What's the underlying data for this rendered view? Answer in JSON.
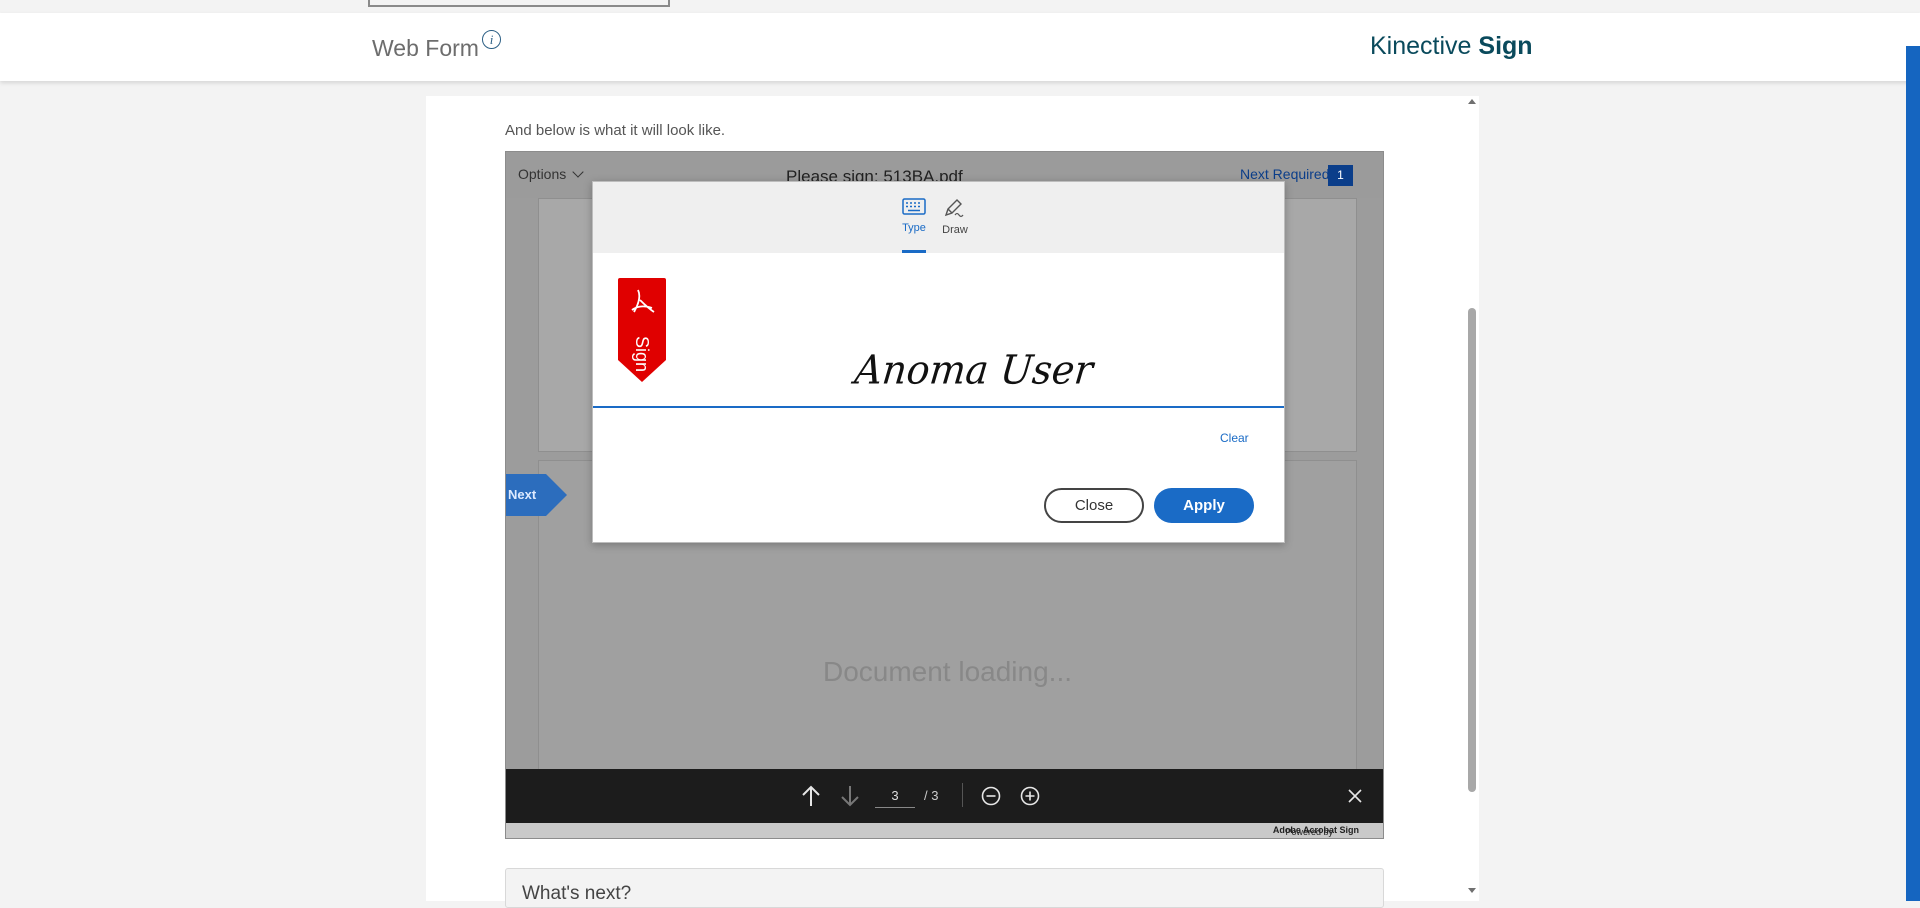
{
  "header": {
    "title": "Web Form",
    "info_icon": "i",
    "brand_light": "Kinective",
    "brand_bold": "Sign"
  },
  "intro_text": "And below is what it will look like.",
  "viewer": {
    "options_label": "Options",
    "document_title": "Please sign: 513BA.pdf",
    "next_required_label": "Next Required",
    "next_required_count": "1",
    "next_tab_label": "Next",
    "loading_text": "Document loading...",
    "current_page": "3",
    "total_pages": "/ 3",
    "powered_by": "Powered by",
    "powered_brand": "Adobe Acrobat Sign"
  },
  "signature_dialog": {
    "tabs": [
      {
        "label": "Type",
        "icon": "keyboard-icon",
        "active": true
      },
      {
        "label": "Draw",
        "icon": "pen-icon",
        "active": false
      }
    ],
    "sign_flag_label": "Sign",
    "signature_text": "Anoma User",
    "clear_label": "Clear",
    "close_label": "Close",
    "apply_label": "Apply"
  },
  "whats_next_label": "What's next?",
  "colors": {
    "accent": "#1a6bc6",
    "brand": "#0a4a5c",
    "sign_flag": "#e00000",
    "viewer_bottom_bar": "#1c1c1c"
  }
}
